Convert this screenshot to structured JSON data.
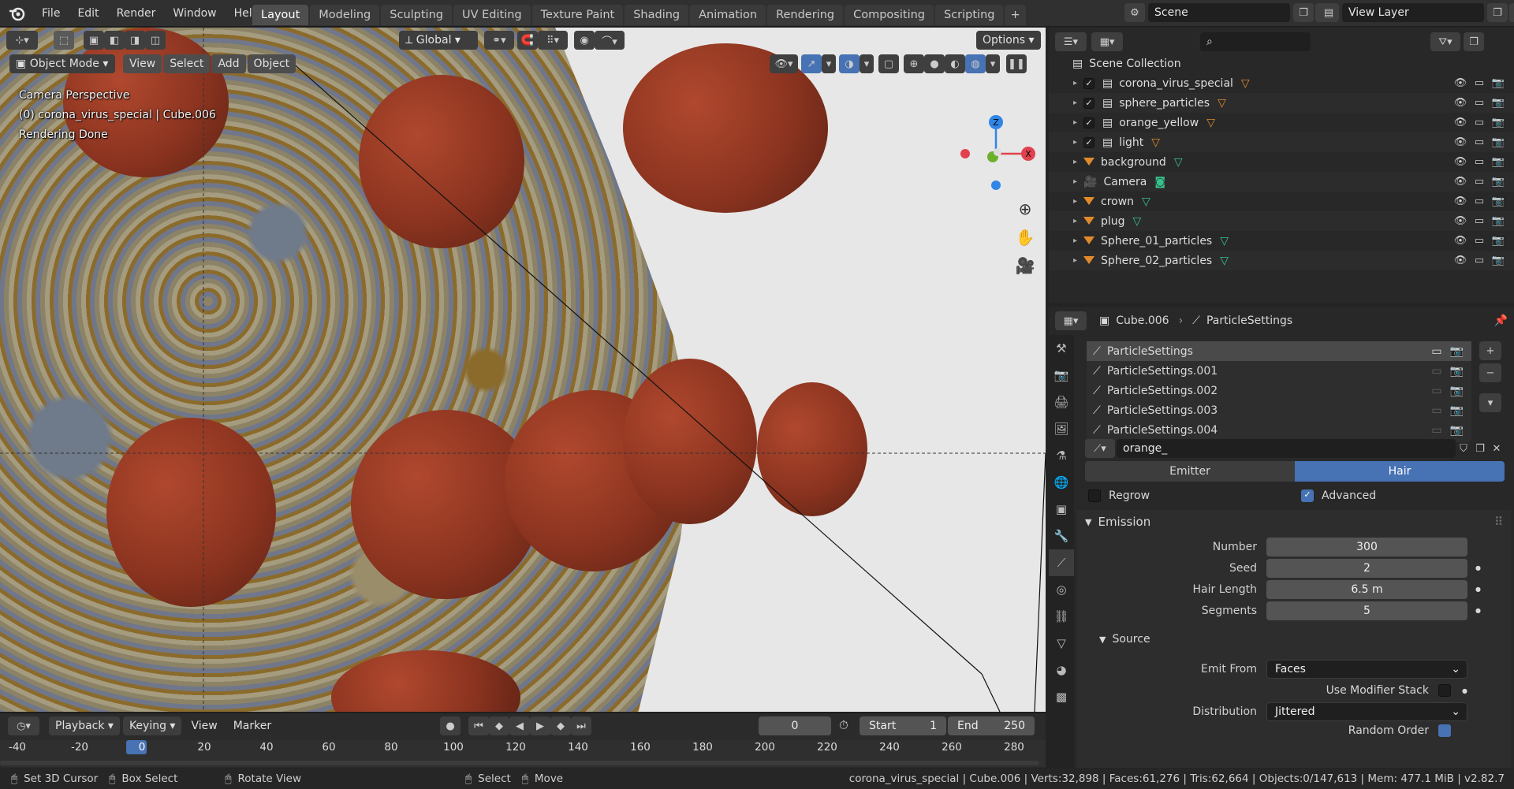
{
  "topbar": {
    "menus": [
      "File",
      "Edit",
      "Render",
      "Window",
      "Help"
    ],
    "workspaces": [
      "Layout",
      "Modeling",
      "Sculpting",
      "UV Editing",
      "Texture Paint",
      "Shading",
      "Animation",
      "Rendering",
      "Compositing",
      "Scripting"
    ],
    "active_workspace": "Layout",
    "scene": "Scene",
    "view_layer": "View Layer"
  },
  "viewport_header": {
    "transform_orientation": "Global",
    "options_label": "Options",
    "mode": "Object Mode",
    "menus": [
      "View",
      "Select",
      "Add",
      "Object"
    ]
  },
  "viewport_overlay": {
    "line1": "Camera Perspective",
    "line2": "(0) corona_virus_special | Cube.006",
    "line3": "Rendering Done"
  },
  "gizmo": {
    "z": "Z",
    "x": "X"
  },
  "outliner": {
    "root": "Scene Collection",
    "items": [
      {
        "label": "corona_virus_special",
        "type": "collection",
        "checked": true
      },
      {
        "label": "sphere_particles",
        "type": "collection",
        "checked": true
      },
      {
        "label": "orange_yellow",
        "type": "collection",
        "checked": true
      },
      {
        "label": "light",
        "type": "collection",
        "checked": true
      },
      {
        "label": "background",
        "type": "mesh"
      },
      {
        "label": "Camera",
        "type": "camera"
      },
      {
        "label": "crown",
        "type": "mesh"
      },
      {
        "label": "plug",
        "type": "mesh"
      },
      {
        "label": "Sphere_01_particles",
        "type": "mesh"
      },
      {
        "label": "Sphere_02_particles",
        "type": "mesh"
      }
    ]
  },
  "properties": {
    "breadcrumb_object": "Cube.006",
    "breadcrumb_data": "ParticleSettings",
    "particle_systems": [
      "ParticleSettings",
      "ParticleSettings.001",
      "ParticleSettings.002",
      "ParticleSettings.003",
      "ParticleSettings.004"
    ],
    "settings_name": "orange_",
    "type_emitter": "Emitter",
    "type_hair": "Hair",
    "regrow": "Regrow",
    "advanced": "Advanced",
    "emission_title": "Emission",
    "number_label": "Number",
    "number_value": "300",
    "seed_label": "Seed",
    "seed_value": "2",
    "hair_length_label": "Hair Length",
    "hair_length_value": "6.5 m",
    "segments_label": "Segments",
    "segments_value": "5",
    "source_title": "Source",
    "emit_from_label": "Emit From",
    "emit_from_value": "Faces",
    "use_modifier_stack": "Use Modifier Stack",
    "distribution_label": "Distribution",
    "distribution_value": "Jittered",
    "random_order": "Random Order"
  },
  "timeline": {
    "playback": "Playback",
    "keying": "Keying",
    "view": "View",
    "marker": "Marker",
    "current_frame": "0",
    "start_label": "Start",
    "start_value": "1",
    "end_label": "End",
    "end_value": "250",
    "ticks": [
      "-40",
      "-20",
      "0",
      "20",
      "40",
      "60",
      "80",
      "100",
      "120",
      "140",
      "160",
      "180",
      "200",
      "220",
      "240",
      "260",
      "280"
    ]
  },
  "statusbar": {
    "set_cursor": "Set 3D Cursor",
    "box_select": "Box Select",
    "rotate_view": "Rotate View",
    "select": "Select",
    "move": "Move",
    "info": "corona_virus_special | Cube.006 | Verts:32,898 | Faces:61,276 | Tris:62,664 | Objects:0/147,613 | Mem: 477.1 MiB | v2.82.7"
  }
}
